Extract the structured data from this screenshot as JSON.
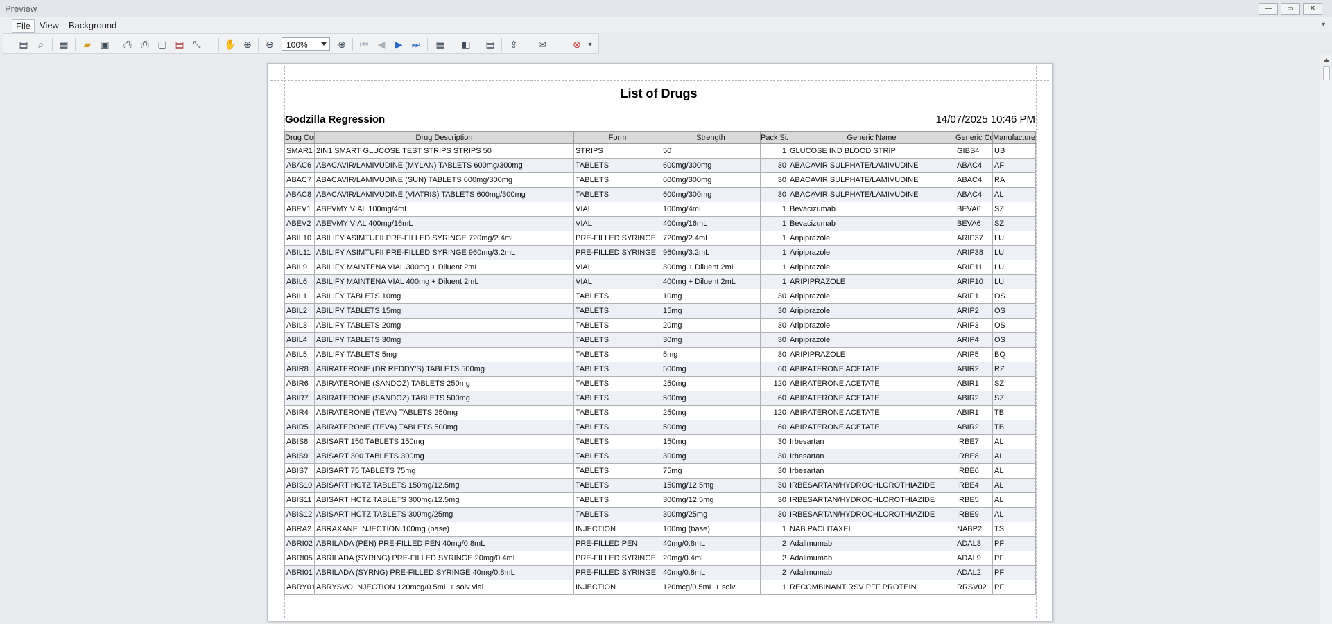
{
  "window": {
    "title": "Preview",
    "buttons": [
      "—",
      "▭",
      "✕"
    ]
  },
  "menu": {
    "items": [
      "File",
      "View",
      "Background"
    ]
  },
  "toolbar": {
    "zoom": "100%"
  },
  "report": {
    "title": "List of Drugs",
    "company": "Godzilla Regression",
    "datetime": "14/07/2025 10:46 PM",
    "columns": [
      "Drug Code",
      "Drug Description",
      "Form",
      "Strength",
      "Pack Size",
      "Generic Name",
      "Generic Code",
      "Manufacturer"
    ],
    "rows": [
      [
        "SMAR1",
        "2IN1 SMART GLUCOSE TEST STRIPS STRIPS 50",
        "STRIPS",
        "50",
        "1",
        "GLUCOSE IND BLOOD STRIP",
        "GIBS4",
        "UB"
      ],
      [
        "ABAC6",
        "ABACAVIR/LAMIVUDINE (MYLAN) TABLETS 600mg/300mg",
        "TABLETS",
        "600mg/300mg",
        "30",
        "ABACAVIR SULPHATE/LAMIVUDINE",
        "ABAC4",
        "AF"
      ],
      [
        "ABAC7",
        "ABACAVIR/LAMIVUDINE (SUN) TABLETS 600mg/300mg",
        "TABLETS",
        "600mg/300mg",
        "30",
        "ABACAVIR SULPHATE/LAMIVUDINE",
        "ABAC4",
        "RA"
      ],
      [
        "ABAC8",
        "ABACAVIR/LAMIVUDINE (VIATRIS) TABLETS 600mg/300mg",
        "TABLETS",
        "600mg/300mg",
        "30",
        "ABACAVIR SULPHATE/LAMIVUDINE",
        "ABAC4",
        "AL"
      ],
      [
        "ABEV1",
        "ABEVMY VIAL 100mg/4mL",
        "VIAL",
        "100mg/4mL",
        "1",
        "Bevacizumab",
        "BEVA6",
        "SZ"
      ],
      [
        "ABEV2",
        "ABEVMY VIAL 400mg/16mL",
        "VIAL",
        "400mg/16mL",
        "1",
        "Bevacizumab",
        "BEVA6",
        "SZ"
      ],
      [
        "ABIL10",
        "ABILIFY ASIMTUFII PRE-FILLED SYRINGE 720mg/2.4mL",
        "PRE-FILLED SYRINGE",
        "720mg/2.4mL",
        "1",
        "Aripiprazole",
        "ARIP37",
        "LU"
      ],
      [
        "ABIL11",
        "ABILIFY ASIMTUFII PRE-FILLED SYRINGE 960mg/3.2mL",
        "PRE-FILLED SYRINGE",
        "960mg/3.2mL",
        "1",
        "Aripiprazole",
        "ARIP38",
        "LU"
      ],
      [
        "ABIL9",
        "ABILIFY MAINTENA VIAL 300mg + Diluent 2mL",
        "VIAL",
        "300mg + Diluent 2mL",
        "1",
        "Aripiprazole",
        "ARIP11",
        "LU"
      ],
      [
        "ABIL6",
        "ABILIFY MAINTENA VIAL 400mg + Diluent 2mL",
        "VIAL",
        "400mg + Diluent 2mL",
        "1",
        "ARIPIPRAZOLE",
        "ARIP10",
        "LU"
      ],
      [
        "ABIL1",
        "ABILIFY TABLETS 10mg",
        "TABLETS",
        "10mg",
        "30",
        "Aripiprazole",
        "ARIP1",
        "OS"
      ],
      [
        "ABIL2",
        "ABILIFY TABLETS 15mg",
        "TABLETS",
        "15mg",
        "30",
        "Aripiprazole",
        "ARIP2",
        "OS"
      ],
      [
        "ABIL3",
        "ABILIFY TABLETS 20mg",
        "TABLETS",
        "20mg",
        "30",
        "Aripiprazole",
        "ARIP3",
        "OS"
      ],
      [
        "ABIL4",
        "ABILIFY TABLETS 30mg",
        "TABLETS",
        "30mg",
        "30",
        "Aripiprazole",
        "ARIP4",
        "OS"
      ],
      [
        "ABIL5",
        "ABILIFY TABLETS 5mg",
        "TABLETS",
        "5mg",
        "30",
        "ARIPIPRAZOLE",
        "ARIP5",
        "BQ"
      ],
      [
        "ABIR8",
        "ABIRATERONE (DR REDDY'S) TABLETS 500mg",
        "TABLETS",
        "500mg",
        "60",
        "ABIRATERONE ACETATE",
        "ABIR2",
        "RZ"
      ],
      [
        "ABIR6",
        "ABIRATERONE (SANDOZ) TABLETS 250mg",
        "TABLETS",
        "250mg",
        "120",
        "ABIRATERONE ACETATE",
        "ABIR1",
        "SZ"
      ],
      [
        "ABIR7",
        "ABIRATERONE (SANDOZ) TABLETS 500mg",
        "TABLETS",
        "500mg",
        "60",
        "ABIRATERONE ACETATE",
        "ABIR2",
        "SZ"
      ],
      [
        "ABIR4",
        "ABIRATERONE (TEVA) TABLETS 250mg",
        "TABLETS",
        "250mg",
        "120",
        "ABIRATERONE ACETATE",
        "ABIR1",
        "TB"
      ],
      [
        "ABIR5",
        "ABIRATERONE (TEVA) TABLETS 500mg",
        "TABLETS",
        "500mg",
        "60",
        "ABIRATERONE ACETATE",
        "ABIR2",
        "TB"
      ],
      [
        "ABIS8",
        "ABISART 150 TABLETS 150mg",
        "TABLETS",
        "150mg",
        "30",
        "Irbesartan",
        "IRBE7",
        "AL"
      ],
      [
        "ABIS9",
        "ABISART 300 TABLETS 300mg",
        "TABLETS",
        "300mg",
        "30",
        "Irbesartan",
        "IRBE8",
        "AL"
      ],
      [
        "ABIS7",
        "ABISART 75 TABLETS 75mg",
        "TABLETS",
        "75mg",
        "30",
        "Irbesartan",
        "IRBE6",
        "AL"
      ],
      [
        "ABIS10",
        "ABISART HCTZ TABLETS 150mg/12.5mg",
        "TABLETS",
        "150mg/12.5mg",
        "30",
        "IRBESARTAN/HYDROCHLOROTHIAZIDE",
        "IRBE4",
        "AL"
      ],
      [
        "ABIS11",
        "ABISART HCTZ TABLETS 300mg/12.5mg",
        "TABLETS",
        "300mg/12.5mg",
        "30",
        "IRBESARTAN/HYDROCHLOROTHIAZIDE",
        "IRBE5",
        "AL"
      ],
      [
        "ABIS12",
        "ABISART HCTZ TABLETS 300mg/25mg",
        "TABLETS",
        "300mg/25mg",
        "30",
        "IRBESARTAN/HYDROCHLOROTHIAZIDE",
        "IRBE9",
        "AL"
      ],
      [
        "ABRA2",
        "ABRAXANE INJECTION 100mg (base)",
        "INJECTION",
        "100mg (base)",
        "1",
        "NAB PACLITAXEL",
        "NABP2",
        "TS"
      ],
      [
        "ABRI02",
        "ABRILADA (PEN) PRE-FILLED PEN 40mg/0.8mL",
        "PRE-FILLED PEN",
        "40mg/0.8mL",
        "2",
        "Adalimumab",
        "ADAL3",
        "PF"
      ],
      [
        "ABRI05",
        "ABRILADA (SYRING) PRE-FILLED SYRINGE 20mg/0.4mL",
        "PRE-FILLED SYRINGE",
        "20mg/0.4mL",
        "2",
        "Adalimumab",
        "ADAL9",
        "PF"
      ],
      [
        "ABRI01",
        "ABRILADA (SYRNG) PRE-FILLED SYRINGE 40mg/0.8mL",
        "PRE-FILLED SYRINGE",
        "40mg/0.8mL",
        "2",
        "Adalimumab",
        "ADAL2",
        "PF"
      ],
      [
        "ABRY01",
        "ABRYSVO INJECTION 120mcg/0.5mL + solv vial",
        "INJECTION",
        "120mcg/0.5mL + solv",
        "1",
        "RECOMBINANT RSV PFF PROTEIN",
        "RRSV02",
        "PF"
      ]
    ]
  }
}
